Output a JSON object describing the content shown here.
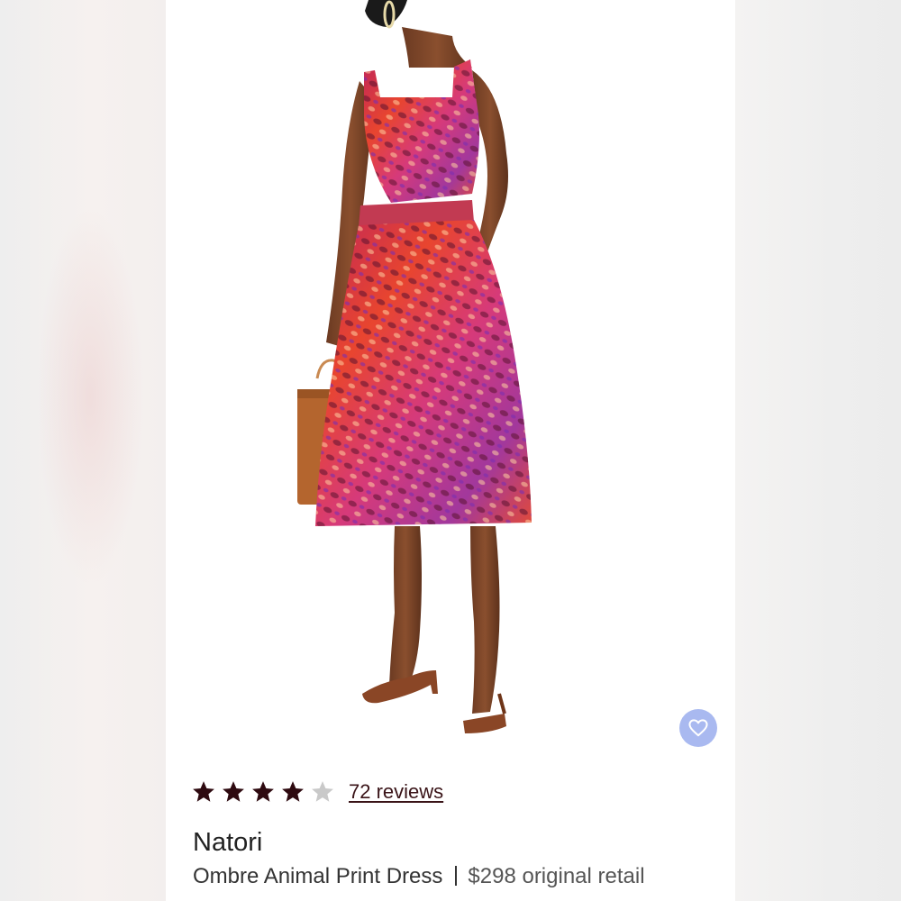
{
  "colors": {
    "background": "#f1f0ef",
    "card": "#ffffff",
    "star_filled": "#2e0a10",
    "star_empty": "#c9c9c9",
    "favorite_button": "#a9b9f0",
    "reviews_link": "#3a1418"
  },
  "product": {
    "image_icon": "product-photo",
    "rating": {
      "value": 4,
      "max": 5,
      "reviews_label": "72 reviews"
    },
    "brand": "Natori",
    "name": "Ombre Animal Print Dress",
    "price": "$298 original retail"
  },
  "favorite": {
    "icon": "heart-outline-icon"
  }
}
